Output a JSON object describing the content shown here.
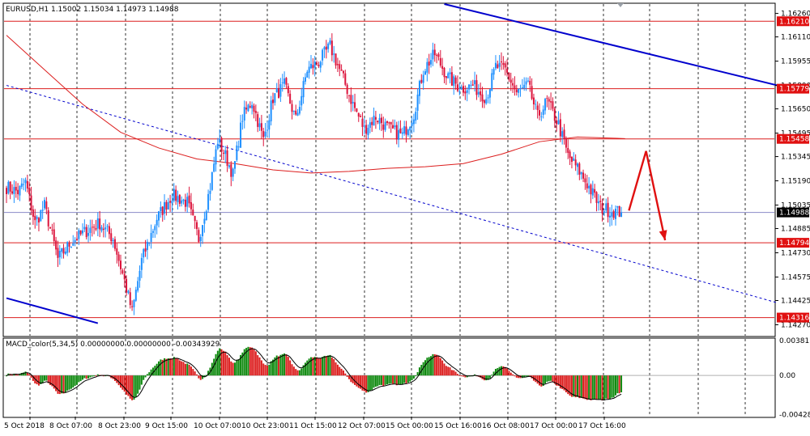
{
  "chart_data": {
    "type": "candlestick",
    "symbol_line": "EURUSD,H1  1.15002 1.15034 1.14973 1.14988",
    "macd_line": "MACD_color(5,34,5) 0.00000000 0.00000000 -0.00343929",
    "colors": {
      "background": "#ffffff",
      "bull": "#1e90ff",
      "bear": "#dc143c",
      "level": "#dc1e1e",
      "trend": "#0000cd",
      "ma": "#dc1e1e",
      "macd_up": "#108a10",
      "macd_down": "#dc1e1e",
      "signal": "#000000",
      "arrow": "#e01010",
      "grid": "#000000"
    },
    "price_axis": {
      "ylim": [
        1.142,
        1.1632
      ],
      "ticks": [
        "1.16260",
        "1.16110",
        "1.15955",
        "1.15800",
        "1.15650",
        "1.15495",
        "1.15345",
        "1.15190",
        "1.15035",
        "1.14885",
        "1.14730",
        "1.14575",
        "1.14425",
        "1.14270"
      ]
    },
    "price_tags": [
      {
        "value": 1.1621,
        "label": "1.16210"
      },
      {
        "value": 1.15779,
        "label": "1.15779"
      },
      {
        "value": 1.15458,
        "label": "1.15458"
      },
      {
        "value": 1.14988,
        "label": "1.14988"
      },
      {
        "value": 1.14794,
        "label": "1.14794"
      },
      {
        "value": 1.14316,
        "label": "1.14316"
      }
    ],
    "horizontal_levels": [
      1.1621,
      1.15779,
      1.15458,
      1.14988,
      1.14794,
      1.14316
    ],
    "macd_axis": {
      "ylim": [
        -0.0045,
        0.004
      ],
      "ticks": [
        {
          "value": 0.0038176,
          "label": "0.0038176"
        },
        {
          "value": 0.0,
          "label": "0.00"
        },
        {
          "value": -0.0042834,
          "label": "-0.004283"
        }
      ]
    },
    "time_labels": [
      "5 Oct 2018",
      "8 Oct 07:00",
      "8 Oct 23:00",
      "9 Oct 15:00",
      "10 Oct 07:00",
      "10 Oct 23:00",
      "11 Oct 15:00",
      "12 Oct 07:00",
      "15 Oct 00:00",
      "15 Oct 16:00",
      "16 Oct 08:00",
      "17 Oct 00:00",
      "17 Oct 16:00"
    ],
    "close_anchors": [
      [
        0,
        1.1515
      ],
      [
        6,
        1.1512
      ],
      [
        10,
        1.1518
      ],
      [
        15,
        1.1492
      ],
      [
        20,
        1.1503
      ],
      [
        27,
        1.1469
      ],
      [
        34,
        1.148
      ],
      [
        42,
        1.1487
      ],
      [
        49,
        1.1492
      ],
      [
        56,
        1.1482
      ],
      [
        62,
        1.1455
      ],
      [
        66,
        1.1435
      ],
      [
        71,
        1.1468
      ],
      [
        79,
        1.1495
      ],
      [
        87,
        1.151
      ],
      [
        95,
        1.1505
      ],
      [
        101,
        1.1482
      ],
      [
        107,
        1.1515
      ],
      [
        111,
        1.1545
      ],
      [
        115,
        1.1535
      ],
      [
        119,
        1.1523
      ],
      [
        124,
        1.156
      ],
      [
        129,
        1.157
      ],
      [
        135,
        1.1545
      ],
      [
        140,
        1.1572
      ],
      [
        146,
        1.158
      ],
      [
        152,
        1.1558
      ],
      [
        158,
        1.159
      ],
      [
        164,
        1.1595
      ],
      [
        170,
        1.1605
      ],
      [
        175,
        1.159
      ],
      [
        182,
        1.1568
      ],
      [
        188,
        1.1552
      ],
      [
        194,
        1.156
      ],
      [
        201,
        1.1552
      ],
      [
        208,
        1.1548
      ],
      [
        214,
        1.1562
      ],
      [
        219,
        1.159
      ],
      [
        225,
        1.16
      ],
      [
        232,
        1.1585
      ],
      [
        239,
        1.1578
      ],
      [
        245,
        1.158
      ],
      [
        252,
        1.1572
      ],
      [
        257,
        1.1592
      ],
      [
        262,
        1.159
      ],
      [
        268,
        1.1575
      ],
      [
        274,
        1.158
      ],
      [
        279,
        1.156
      ],
      [
        284,
        1.157
      ],
      [
        290,
        1.1555
      ],
      [
        295,
        1.1535
      ],
      [
        301,
        1.1525
      ],
      [
        306,
        1.1515
      ],
      [
        312,
        1.1502
      ],
      [
        317,
        1.15
      ],
      [
        323,
        1.14988
      ]
    ],
    "ma_points": [
      [
        0,
        1.1612
      ],
      [
        20,
        1.159
      ],
      [
        40,
        1.1568
      ],
      [
        60,
        1.155
      ],
      [
        80,
        1.154
      ],
      [
        100,
        1.1533
      ],
      [
        120,
        1.153
      ],
      [
        140,
        1.1526
      ],
      [
        160,
        1.1524
      ],
      [
        180,
        1.1525
      ],
      [
        200,
        1.1527
      ],
      [
        220,
        1.1528
      ],
      [
        240,
        1.153
      ],
      [
        260,
        1.1536
      ],
      [
        280,
        1.1544
      ],
      [
        300,
        1.1547
      ],
      [
        325,
        1.1546
      ]
    ],
    "trend_lines": [
      {
        "style": "solid",
        "from": [
          230,
          1.1632
        ],
        "to": [
          405,
          1.158
        ]
      },
      {
        "style": "solid",
        "from": [
          0,
          1.1444
        ],
        "to": [
          48,
          1.1428
        ]
      },
      {
        "style": "dashed",
        "from": [
          0,
          1.158
        ],
        "to": [
          405,
          1.1441
        ]
      }
    ],
    "forecast_arrow": [
      [
        327,
        1.15
      ],
      [
        336,
        1.1538
      ],
      [
        346,
        1.1481
      ]
    ]
  }
}
